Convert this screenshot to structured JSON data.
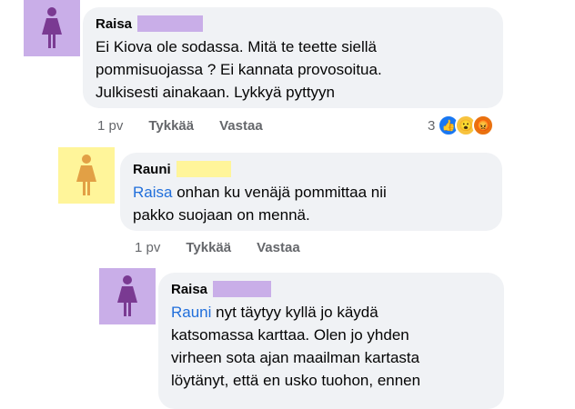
{
  "comments": [
    {
      "author": "Raisa",
      "text": "Ei Kiova ole sodassa. Mitä te teette siellä\npommisuojassa ? Ei kannata provosoitua.\nJulkisesti ainakaan. Lykkyä pyttyyn",
      "time": "1 pv",
      "like": "Tykkää",
      "reply": "Vastaa",
      "reaction_count": "3",
      "reactions": [
        "like-reaction-icon",
        "wow-reaction-icon",
        "angry-reaction-icon"
      ]
    },
    {
      "author": "Rauni",
      "mention": "Raisa",
      "text": " onhan ku venäjä pommittaa nii\npakko suojaan on mennä.",
      "time": "1 pv",
      "like": "Tykkää",
      "reply": "Vastaa"
    },
    {
      "author": "Raisa",
      "mention": "Rauni",
      "text": " nyt täytyy kyllä jo käydä\nkatsomassa karttaa. Olen jo yhden\nvirheen sota ajan maailman kartasta\nlöytänyt, että en usko tuohon, ennen"
    }
  ],
  "colors": {
    "raisa_avatar_bg": "#c9aee8",
    "raisa_avatar_fg": "#7a3a92",
    "rauni_avatar_bg": "#fff59a",
    "rauni_avatar_fg": "#e2a045",
    "raisa_redact": "#c9aee8",
    "rauni_redact": "#fff59a"
  }
}
